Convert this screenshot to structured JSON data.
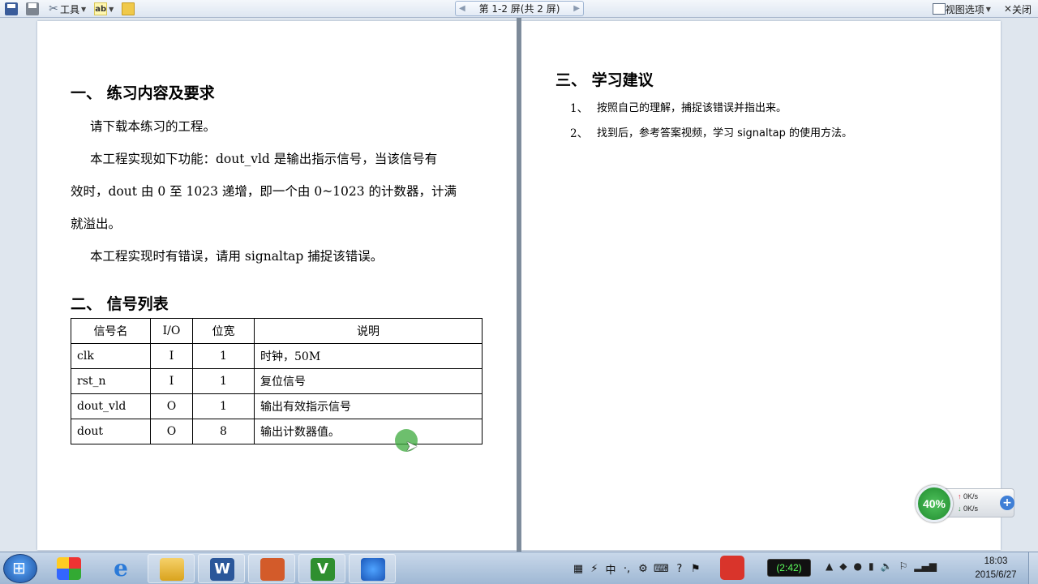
{
  "toolbar": {
    "tools_label": "工具",
    "abc_label": "ab",
    "pager_text": "第 1-2 屏(共 2 屏)",
    "view_options_label": "视图选项",
    "close_label": "关闭"
  },
  "doc": {
    "sec1_title": "一、 练习内容及要求",
    "p1": "请下载本练习的工程。",
    "p2_line1": "本工程实现如下功能：dout_vld 是输出指示信号，当该信号有",
    "p2_line2": "效时，dout 由 0 至 1023 递增，即一个由 0~1023 的计数器，计满",
    "p2_line3": "就溢出。",
    "p3": "本工程实现时有错误，请用 signaltap 捕捉该错误。",
    "sec2_title": "二、 信号列表",
    "table": {
      "headers": [
        "信号名",
        "I/O",
        "位宽",
        "说明"
      ],
      "rows": [
        [
          "clk",
          "I",
          "1",
          "时钟，50M"
        ],
        [
          "rst_n",
          "I",
          "1",
          "复位信号"
        ],
        [
          "dout_vld",
          "O",
          "1",
          "输出有效指示信号"
        ],
        [
          "dout",
          "O",
          "8",
          "输出计数器值。"
        ]
      ]
    },
    "sec3_title": "三、   学习建议",
    "suggestions": [
      {
        "num": "1、",
        "text": "按照自己的理解，捕捉该错误并指出来。"
      },
      {
        "num": "2、",
        "text": "找到后，参考答案视频，学习 signaltap 的使用方法。"
      }
    ]
  },
  "net_widget": {
    "percent": "40%",
    "up": "0K/s",
    "down": "0K/s"
  },
  "taskbar": {
    "ime": "中",
    "battery_time": "(2:42)",
    "time": "18:03",
    "date": "2015/6/27"
  },
  "colors": {
    "toolbar_bg": "#e8eef6",
    "workspace_bg": "#dfe6ee",
    "divider": "#7d8a99",
    "taskbar_bg": "#b4c8e0"
  }
}
